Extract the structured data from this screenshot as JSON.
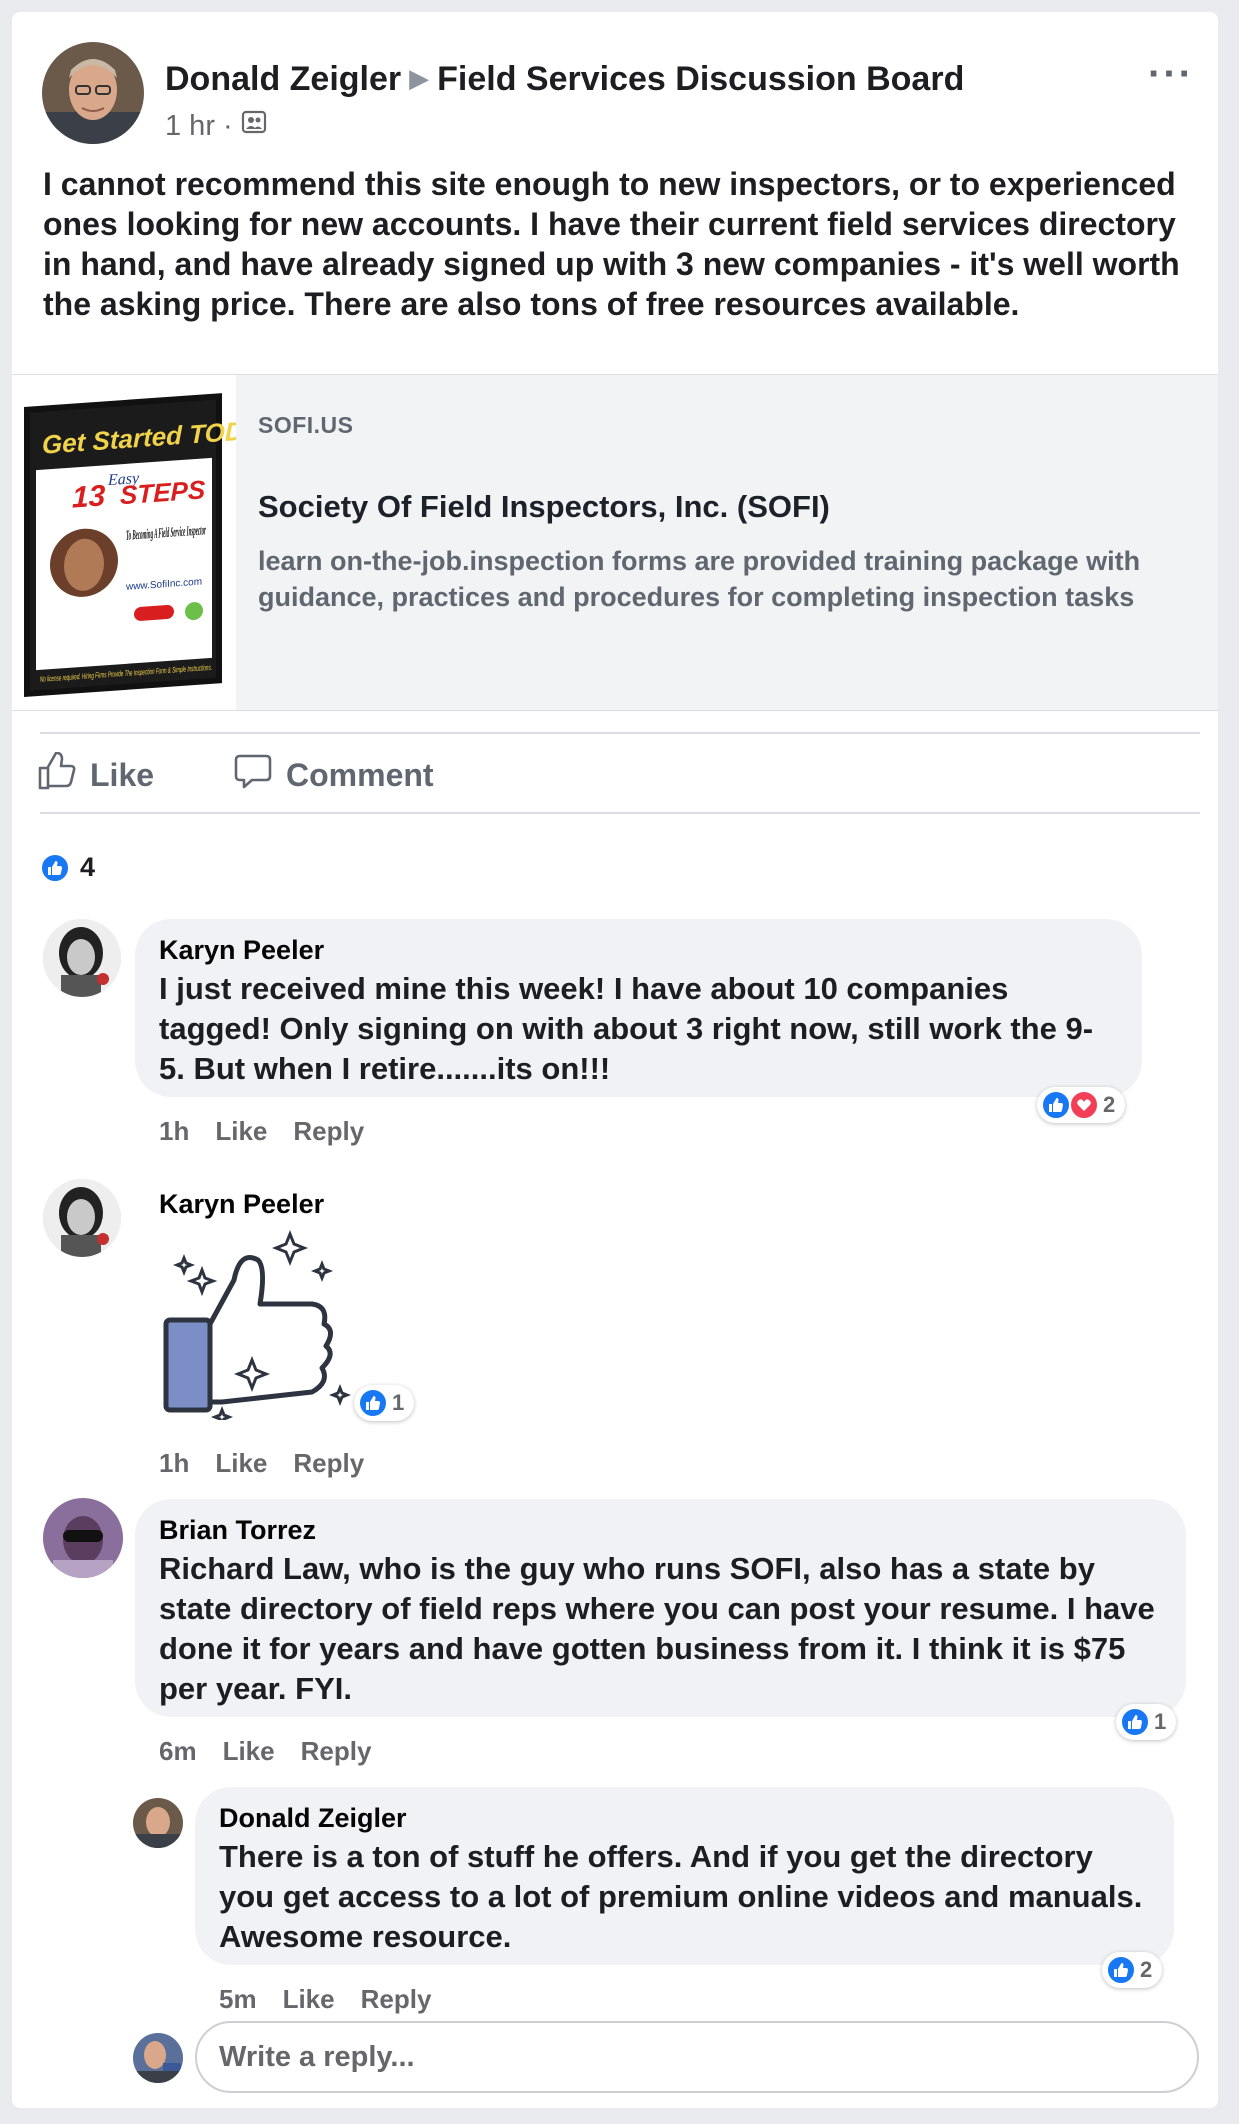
{
  "post": {
    "author": "Donald Zeigler",
    "group": "Field Services Discussion Board",
    "time": "1 hr",
    "text": "I  cannot recommend this site enough to new inspectors, or to experienced  ones looking for new accounts. I have their current field services  directory in hand, and have already signed up with 3 new companies -  it's well worth the asking price. There are also tons of free resources  available."
  },
  "link_preview": {
    "domain": "SOFI.US",
    "title": "Society Of Field Inspectors, Inc. (SOFI)",
    "description": "learn on-the-job.inspection forms are provided training package with guidance, practices and procedures for completing inspection tasks",
    "thumb_title": "Get Started TODAY",
    "thumb_count": "13",
    "thumb_easy": "Easy",
    "thumb_steps": "STEPS",
    "thumb_sub": "To Becoming A Field Service Inspector",
    "thumb_url": "www.SofiInc.com",
    "thumb_footer": "No license required. Hiring Firms Provide The Inspection Form & Simple Instructions."
  },
  "actions": {
    "like": "Like",
    "comment": "Comment"
  },
  "reaction_count": "4",
  "comments": [
    {
      "name": "Karyn Peeler",
      "text": "I just received mine this week! I have about 10 companies tagged! Only signing on with  about 3 right now, still work the 9-5. But when I retire.......its on!!!",
      "time": "1h",
      "like": "Like",
      "reply": "Reply",
      "reactions": "2"
    },
    {
      "name": "Karyn Peeler",
      "sticker": "thumbs-up-sticker",
      "time": "1h",
      "like": "Like",
      "reply": "Reply",
      "reactions": "1"
    },
    {
      "name": "Brian Torrez",
      "text": "Richard Law, who is the guy who runs SOFI, also has a state by state directory of field reps where you can post your resume. I have done it for years and have gotten business from it. I think it is $75 per year. FYI.",
      "time": "6m",
      "like": "Like",
      "reply": "Reply",
      "reactions": "1"
    },
    {
      "name": "Donald Zeigler",
      "text": "There is a ton of stuff he offers. And if you get the directory you get access to a lot of premium online videos and manuals. Awesome resource.",
      "time": "5m",
      "like": "Like",
      "reply": "Reply",
      "reactions": "2"
    }
  ],
  "reply_box": {
    "placeholder": "Write a reply..."
  },
  "colors": {
    "like_blue": "#1877f2",
    "love_red": "#f33e58",
    "bubble_bg": "#f0f2f5"
  }
}
